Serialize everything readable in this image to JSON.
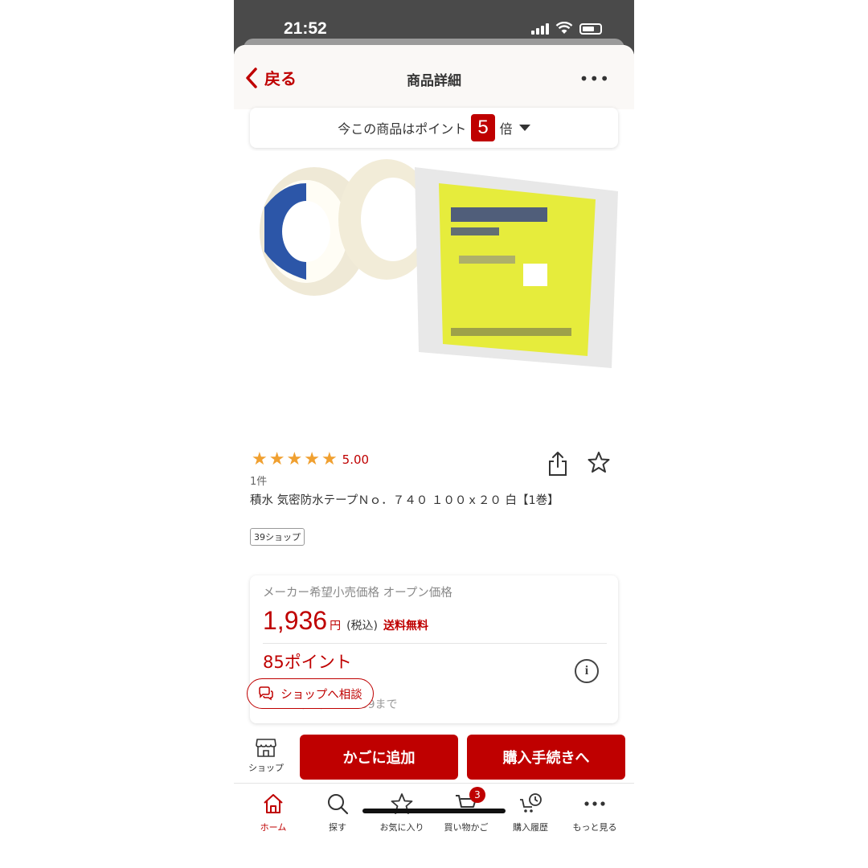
{
  "status_bar": {
    "time": "21:52"
  },
  "nav": {
    "back_label": "戻る",
    "title": "商品詳細",
    "more": "•••"
  },
  "points_banner": {
    "text": "今この商品はポイント",
    "multiplier": "5",
    "suffix": "倍"
  },
  "product": {
    "rating": "5.00",
    "stars": 5,
    "review_count": "1件",
    "title": "積水 気密防水テープＮｏ．７４０ １００ｘ２０ 白【1巻】",
    "shop_tag": "39ショップ"
  },
  "price_card": {
    "msrp": "メーカー希望小売価格 オープン価格",
    "price": "1,936",
    "yen": "円",
    "tax": "(税込)",
    "shipping": "送料無料",
    "points": "85ポイント",
    "deadline": "：2025/06/27 01:59まで"
  },
  "consult": {
    "label": "ショップへ相談"
  },
  "actions": {
    "shop_label": "ショップ",
    "add_cart": "かごに追加",
    "checkout": "購入手続きへ"
  },
  "tabs": [
    {
      "label": "ホーム",
      "icon": "home-icon"
    },
    {
      "label": "探す",
      "icon": "search-icon"
    },
    {
      "label": "お気に入り",
      "icon": "star-icon"
    },
    {
      "label": "買い物かご",
      "icon": "cart-icon",
      "badge": "3"
    },
    {
      "label": "購入履歴",
      "icon": "history-icon"
    },
    {
      "label": "もっと見る",
      "icon": "more-icon"
    }
  ],
  "colors": {
    "accent": "#bf0000",
    "star": "#f0a030"
  }
}
